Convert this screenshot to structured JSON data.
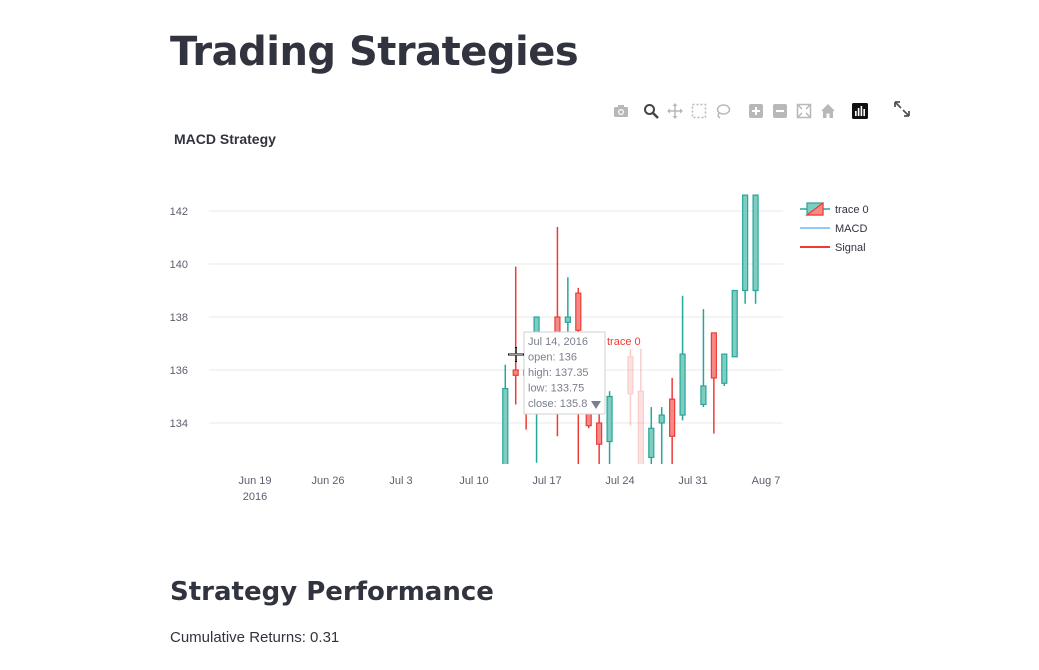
{
  "page": {
    "title": "Trading Strategies"
  },
  "toolbar": {
    "icons": [
      "camera-icon",
      "zoom-icon",
      "pan-icon",
      "box-select-icon",
      "lasso-select-icon",
      "zoom-in-icon",
      "zoom-out-icon",
      "autoscale-icon",
      "reset-axes-icon",
      "plotly-logo-icon"
    ],
    "fullscreen_icon": "fullscreen-icon"
  },
  "chart_data": {
    "type": "candlestick",
    "title": "MACD Strategy",
    "xlabel": "",
    "ylabel": "",
    "x_ticks": [
      "Jun 19",
      "Jun 26",
      "Jul 3",
      "Jul 10",
      "Jul 17",
      "Jul 24",
      "Jul 31",
      "Aug 7"
    ],
    "x_tick_year": "2016",
    "y_ticks": [
      "134",
      "136",
      "138",
      "140",
      "142"
    ],
    "ylim": [
      132.4,
      142.6
    ],
    "grid": true,
    "legend_position": "right",
    "legend": [
      "trace 0",
      "MACD",
      "Signal"
    ],
    "colors": {
      "increasing": "#26a69a",
      "decreasing": "#ef3b36",
      "macd": "#90caf9",
      "signal": "#ef3b36"
    },
    "series": [
      {
        "name": "trace 0",
        "type": "candlestick",
        "x": [
          "Jul 13",
          "Jul 14",
          "Jul 15",
          "Jul 16",
          "Jul 18",
          "Jul 19",
          "Jul 20",
          "Jul 21",
          "Jul 22",
          "Jul 23",
          "Jul 25",
          "Jul 26",
          "Jul 27",
          "Jul 28",
          "Jul 29",
          "Jul 30",
          "Aug 1",
          "Aug 2",
          "Aug 3",
          "Aug 4",
          "Aug 5",
          "Aug 6"
        ],
        "open": [
          132.4,
          136.0,
          136.0,
          137.0,
          138.0,
          137.8,
          138.9,
          136.4,
          134.0,
          133.3,
          136.5,
          135.2,
          132.7,
          134.0,
          134.9,
          134.3,
          134.7,
          137.4,
          135.5,
          136.5,
          139.0,
          139.0
        ],
        "high": [
          136.2,
          139.9,
          137.35,
          138.0,
          141.4,
          139.5,
          139.1,
          137.4,
          135.0,
          135.2,
          136.8,
          136.8,
          134.6,
          134.6,
          135.7,
          138.8,
          138.3,
          137.2,
          136.6,
          138.0,
          142.6,
          142.6
        ],
        "low": [
          132.4,
          134.7,
          133.75,
          132.5,
          133.5,
          134.5,
          132.4,
          133.8,
          132.4,
          132.4,
          133.9,
          132.4,
          132.4,
          132.4,
          132.4,
          134.1,
          134.6,
          133.6,
          135.4,
          138.5,
          138.5,
          138.5
        ],
        "close": [
          135.3,
          135.8,
          135.8,
          138.0,
          136.9,
          138.0,
          137.5,
          133.9,
          133.2,
          135.0,
          135.1,
          132.4,
          133.8,
          134.3,
          133.5,
          136.6,
          135.4,
          135.7,
          136.6,
          139.0,
          142.6,
          142.6
        ]
      },
      {
        "name": "MACD",
        "type": "line",
        "values": []
      },
      {
        "name": "Signal",
        "type": "line",
        "values": []
      }
    ],
    "tooltip": {
      "date": "Jul 14, 2016",
      "open": "open: 136",
      "high": "high: 137.35",
      "low": "low: 133.75",
      "close": "close: 135.8",
      "trace_label": "trace 0"
    }
  },
  "performance": {
    "heading": "Strategy Performance",
    "cumulative_returns": "Cumulative Returns: 0.31"
  }
}
